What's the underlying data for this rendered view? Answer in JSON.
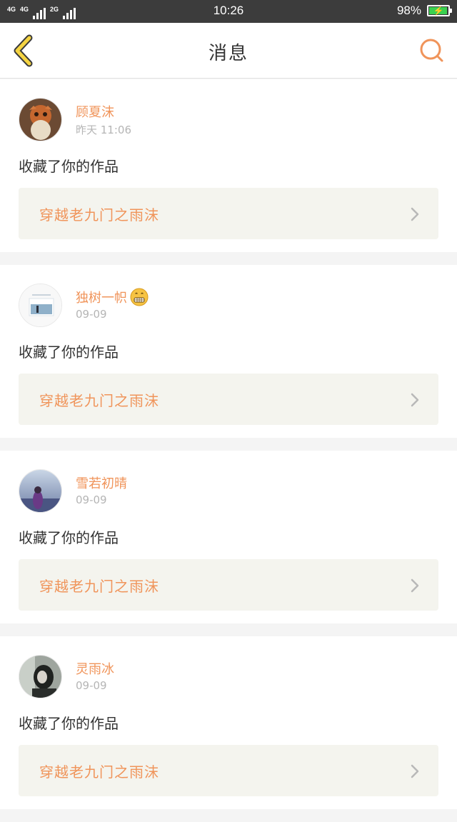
{
  "status_bar": {
    "network_1": "4G",
    "network_2": "4G",
    "network_3": "2G",
    "time": "10:26",
    "battery_percent": "98%",
    "battery_level": 0.98
  },
  "header": {
    "title": "消息",
    "back_icon": "chevron-left-icon",
    "search_icon": "search-icon"
  },
  "colors": {
    "accent": "#f0945a",
    "back_arrow": "#f5d442",
    "card_link_bg": "#f4f4ee",
    "status_bar_bg": "#3c3c3c"
  },
  "messages": [
    {
      "username": "顾夏沫",
      "timestamp": "昨天 11:06",
      "action": "收藏了你的作品",
      "work_title": "穿越老九门之雨沫",
      "has_emoji": false
    },
    {
      "username": "独树一帜",
      "timestamp": "09-09",
      "action": "收藏了你的作品",
      "work_title": "穿越老九门之雨沫",
      "has_emoji": true
    },
    {
      "username": "雪若初晴",
      "timestamp": "09-09",
      "action": "收藏了你的作品",
      "work_title": "穿越老九门之雨沫",
      "has_emoji": false
    },
    {
      "username": "灵雨冰",
      "timestamp": "09-09",
      "action": "收藏了你的作品",
      "work_title": "穿越老九门之雨沫",
      "has_emoji": false
    }
  ]
}
